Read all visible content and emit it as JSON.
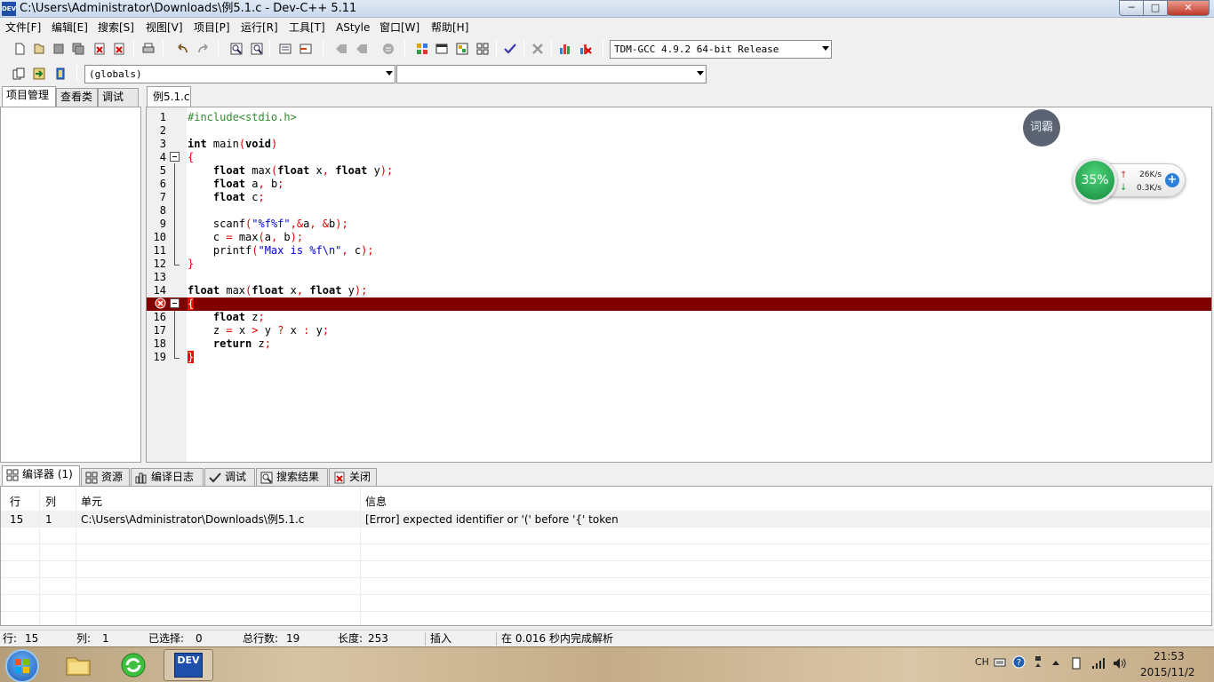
{
  "window": {
    "logo_text": "DEV",
    "title": "C:\\Users\\Administrator\\Downloads\\例5.1.c - Dev-C++ 5.11",
    "minimize": "─",
    "maximize": "□",
    "close": "✕"
  },
  "menu": [
    "文件[F]",
    "编辑[E]",
    "搜索[S]",
    "视图[V]",
    "项目[P]",
    "运行[R]",
    "工具[T]",
    "AStyle",
    "窗口[W]",
    "帮助[H]"
  ],
  "toolbar": {
    "compiler_select": "TDM-GCC 4.9.2 64-bit Release",
    "scope_select": "(globals)",
    "symbol_select": ""
  },
  "left_tabs": [
    "项目管理",
    "查看类",
    "调试"
  ],
  "editor": {
    "tab_label": "例5.1.c",
    "error_line": 15,
    "lines": [
      {
        "num": "1",
        "tokens": [
          [
            "pre",
            "#include<stdio.h>"
          ]
        ]
      },
      {
        "num": "2",
        "tokens": []
      },
      {
        "num": "3",
        "tokens": [
          [
            "kw",
            "int"
          ],
          [
            "id",
            " main"
          ],
          [
            "sym",
            "("
          ],
          [
            "kw",
            "void"
          ],
          [
            "sym",
            ")"
          ]
        ]
      },
      {
        "num": "4",
        "tokens": [
          [
            "sym",
            "{"
          ]
        ]
      },
      {
        "num": "5",
        "tokens": [
          [
            "id",
            "    "
          ],
          [
            "kw",
            "float"
          ],
          [
            "id",
            " max"
          ],
          [
            "sym",
            "("
          ],
          [
            "kw",
            "float"
          ],
          [
            "id",
            " x"
          ],
          [
            "sym",
            ","
          ],
          [
            "id",
            " "
          ],
          [
            "kw",
            "float"
          ],
          [
            "id",
            " y"
          ],
          [
            "sym",
            ");"
          ]
        ]
      },
      {
        "num": "6",
        "tokens": [
          [
            "id",
            "    "
          ],
          [
            "kw",
            "float"
          ],
          [
            "id",
            " a"
          ],
          [
            "sym",
            ","
          ],
          [
            "id",
            " b"
          ],
          [
            "sym",
            ";"
          ]
        ]
      },
      {
        "num": "7",
        "tokens": [
          [
            "id",
            "    "
          ],
          [
            "kw",
            "float"
          ],
          [
            "id",
            " c"
          ],
          [
            "sym",
            ";"
          ]
        ]
      },
      {
        "num": "8",
        "tokens": []
      },
      {
        "num": "9",
        "tokens": [
          [
            "id",
            "    scanf"
          ],
          [
            "sym",
            "("
          ],
          [
            "str",
            "\"%f%f\""
          ],
          [
            "sym",
            ",&"
          ],
          [
            "id",
            "a"
          ],
          [
            "sym",
            ","
          ],
          [
            "id",
            " "
          ],
          [
            "sym",
            "&"
          ],
          [
            "id",
            "b"
          ],
          [
            "sym",
            ");"
          ]
        ]
      },
      {
        "num": "10",
        "tokens": [
          [
            "id",
            "    c "
          ],
          [
            "sym",
            "="
          ],
          [
            "id",
            " max"
          ],
          [
            "sym",
            "("
          ],
          [
            "id",
            "a"
          ],
          [
            "sym",
            ","
          ],
          [
            "id",
            " b"
          ],
          [
            "sym",
            ");"
          ]
        ]
      },
      {
        "num": "11",
        "tokens": [
          [
            "id",
            "    printf"
          ],
          [
            "sym",
            "("
          ],
          [
            "str",
            "\"Max is %f\\n\""
          ],
          [
            "sym",
            ","
          ],
          [
            "id",
            " c"
          ],
          [
            "sym",
            ");"
          ]
        ]
      },
      {
        "num": "12",
        "tokens": [
          [
            "sym",
            "}"
          ]
        ]
      },
      {
        "num": "13",
        "tokens": []
      },
      {
        "num": "14",
        "tokens": [
          [
            "kw",
            "float"
          ],
          [
            "id",
            " max"
          ],
          [
            "sym",
            "("
          ],
          [
            "kw",
            "float"
          ],
          [
            "id",
            " x"
          ],
          [
            "sym",
            ","
          ],
          [
            "id",
            " "
          ],
          [
            "kw",
            "float"
          ],
          [
            "id",
            " y"
          ],
          [
            "sym",
            ");"
          ]
        ]
      },
      {
        "num": "15",
        "tokens": [
          [
            "sym",
            "{"
          ]
        ]
      },
      {
        "num": "16",
        "tokens": [
          [
            "id",
            "    "
          ],
          [
            "kw",
            "float"
          ],
          [
            "id",
            " z"
          ],
          [
            "sym",
            ";"
          ]
        ]
      },
      {
        "num": "17",
        "tokens": [
          [
            "id",
            "    z "
          ],
          [
            "sym",
            "="
          ],
          [
            "id",
            " x "
          ],
          [
            "sym",
            ">"
          ],
          [
            "id",
            " y "
          ],
          [
            "sym",
            "?"
          ],
          [
            "id",
            " x "
          ],
          [
            "sym",
            ":"
          ],
          [
            "id",
            " y"
          ],
          [
            "sym",
            ";"
          ]
        ]
      },
      {
        "num": "18",
        "tokens": [
          [
            "id",
            "    "
          ],
          [
            "kw",
            "return"
          ],
          [
            "id",
            " z"
          ],
          [
            "sym",
            ";"
          ]
        ]
      },
      {
        "num": "19",
        "tokens": [
          [
            "sym",
            "}"
          ]
        ]
      }
    ]
  },
  "widgets": {
    "ciba_label": "词霸",
    "cpu_percent": "35%",
    "upload_speed": "26K/s",
    "download_speed": "0.3K/s",
    "plus": "+"
  },
  "bottom_tabs": [
    "编译器 (1)",
    "资源",
    "编译日志",
    "调试",
    "搜索结果",
    "关闭"
  ],
  "messages": {
    "headers": {
      "row": "行",
      "col": "列",
      "unit": "单元",
      "info": "信息"
    },
    "rows": [
      {
        "row": "15",
        "col": "1",
        "unit": "C:\\Users\\Administrator\\Downloads\\例5.1.c",
        "info": "[Error] expected identifier or '(' before '{' token"
      }
    ]
  },
  "status": {
    "row_label": "行:",
    "row_value": "15",
    "col_label": "列:",
    "col_value": "1",
    "sel_label": "已选择:",
    "sel_value": "0",
    "total_label": "总行数:",
    "total_value": "19",
    "len_label": "长度:",
    "len_value": "253",
    "mode": "插入",
    "parse_msg": "在 0.016 秒内完成解析"
  },
  "taskbar": {
    "dev_label": "DEV",
    "ime": "CH",
    "time": "21:53",
    "date": "2015/11/2"
  },
  "colors": {
    "error_highlight": "#800000",
    "keyword": "#000000",
    "symbol": "#e00000",
    "string": "#0000e0",
    "preprocessor": "#2e8b2e"
  }
}
